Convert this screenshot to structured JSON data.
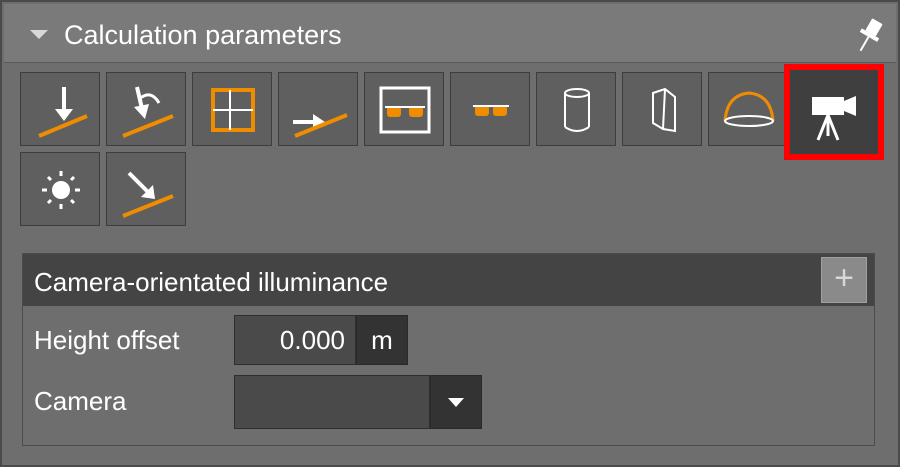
{
  "panel": {
    "title": "Calculation parameters"
  },
  "toolbar": {
    "items": [
      {
        "icon": "vertical-illuminance-plane-icon"
      },
      {
        "icon": "rotated-illuminance-plane-icon"
      },
      {
        "icon": "grid-area-icon"
      },
      {
        "icon": "horizontal-illuminance-plane-icon"
      },
      {
        "icon": "glare-box-icon"
      },
      {
        "icon": "glasses-icon"
      },
      {
        "icon": "cylinder-icon"
      },
      {
        "icon": "semi-cylinder-icon"
      },
      {
        "icon": "hemisphere-icon"
      },
      {
        "icon": "camera-tripod-icon",
        "selected": true
      },
      {
        "icon": "sun-icon"
      },
      {
        "icon": "tilted-illuminance-plane-icon"
      }
    ]
  },
  "section": {
    "title": "Camera-orientated illuminance",
    "add_label": "+",
    "height_offset": {
      "label": "Height offset",
      "value": "0.000",
      "unit": "m"
    },
    "camera": {
      "label": "Camera",
      "value": ""
    }
  },
  "colors": {
    "accent": "#f08c00",
    "highlight": "#ff0000"
  }
}
